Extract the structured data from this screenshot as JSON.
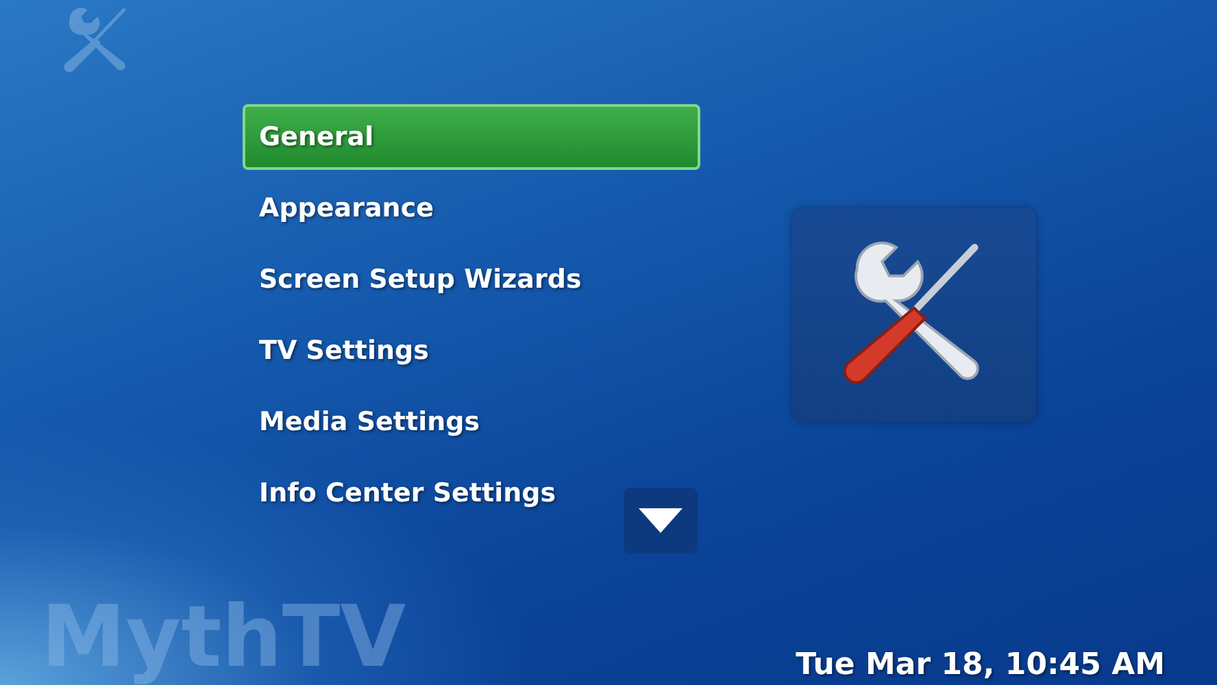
{
  "menu": {
    "items": [
      {
        "label": "General",
        "selected": true
      },
      {
        "label": "Appearance",
        "selected": false
      },
      {
        "label": "Screen Setup Wizards",
        "selected": false
      },
      {
        "label": "TV Settings",
        "selected": false
      },
      {
        "label": "Media Settings",
        "selected": false
      },
      {
        "label": "Info Center Settings",
        "selected": false
      }
    ]
  },
  "logo": {
    "text": "MythTV"
  },
  "clock": {
    "text": "Tue Mar 18, 10:45 AM"
  }
}
